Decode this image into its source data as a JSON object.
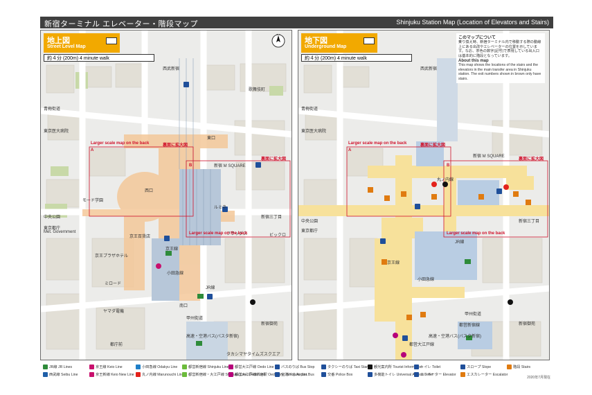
{
  "header": {
    "title_jp": "新宿ターミナル エレベーター・階段マップ",
    "title_en": "Shinjuku Station Map (Location of Elevators and Stairs)"
  },
  "street_map": {
    "title_jp": "地上図",
    "title_en": "Street Level Map",
    "walk": "約４分 (200m) 4 minute walk",
    "compass": "N",
    "labels": {
      "mode_gakuen": "モード学園",
      "seibu_shinjuku": "西武新宿",
      "kabukicho": "歌舞伎町",
      "ome_kaido": "青梅街道",
      "tokyo_med": "東京医大病院",
      "chuo_park": "中央公園",
      "tokyo_tocho": "東京都庁",
      "metro_gov": "Met. Government",
      "keio_plaza": "京王プラザホテル",
      "mylord": "ミロード",
      "shinjuku_m": "新宿 M SQUARE",
      "koshu_kaido": "甲州街道",
      "shinjuku_gyoen": "新宿御苑",
      "takashimaya": "タカシマヤタイムズスクエア",
      "busta": "高速・空港バス(バスタ新宿)",
      "odakyu": "小田急線",
      "jr_line": "JR線",
      "keio_line": "京王線",
      "shinjuku_3": "新宿三丁目",
      "tochomae": "都庁前",
      "nishi_guchi": "西口",
      "higashi_guchi": "東口",
      "minami_guchi": "南口",
      "flags": "フラッグス",
      "bicqlo": "ビックロ",
      "lumine": "ルミネ",
      "yamada": "ヤマダ電機",
      "hoteru": "京王百貨店",
      "large_a": "Larger scale map on the back",
      "large_b": "Larger scale map on the back",
      "a": "A",
      "b": "B",
      "reverse_a": "裏面に拡大図",
      "reverse_b": "裏面に拡大図"
    }
  },
  "underground_map": {
    "title_jp": "地下図",
    "title_en": "Underground Map",
    "walk": "約４分 (200m) 4 minute walk",
    "notice": {
      "h1": "このマップについて",
      "p1": "乗り換え時、新宿ターミナル内で移動する際の動線上にある出改やエレベーターの位置を示しています。なお、茶色の数字(記号)で表現している出入口は基本的に階段となっています。",
      "h2": "About this map",
      "p2": "This map shows the locations of the stairs and the elevators in the main transfer area in Shinjuku station. The exit numbers shown in brown only have stairs."
    },
    "labels": {
      "seibu_shinjuku": "西武新宿",
      "ome_kaido": "青梅街道",
      "tokyo_med": "東京医大病院",
      "chuo_park": "中央公園",
      "tokyo_tocho": "東京都庁",
      "marunouchi": "丸ノ内線",
      "oedo": "都営大江戸線",
      "shinjuku_line": "都営新宿線",
      "keio_line": "京王線",
      "odakyu": "小田急線",
      "jr_line": "JR線",
      "shinjuku_3": "新宿三丁目",
      "shinjuku_gyoen": "新宿御苑",
      "busta": "高速・空港バス(バスタ新宿)",
      "shinjuku_m": "新宿 M SQUARE",
      "large_a": "Larger scale map on the back",
      "large_b": "Larger scale map on the back",
      "a": "A",
      "b": "B",
      "reverse_a": "裏面に拡大図",
      "reverse_b": "裏面に拡大図",
      "koshu_kaido": "甲州街道"
    }
  },
  "legend": {
    "items": [
      {
        "jp": "JR線",
        "en": "JR Lines",
        "color": "#2e8b3a"
      },
      {
        "jp": "西武線",
        "en": "Seibu Line",
        "color": "#1f5fa8"
      },
      {
        "jp": "京王線",
        "en": "Keio Line",
        "color": "#c8106d"
      },
      {
        "jp": "京王新線",
        "en": "Keio New Line",
        "color": "#c8106d"
      },
      {
        "jp": "小田急線",
        "en": "Odakyu Line",
        "color": "#1f7fc8"
      },
      {
        "jp": "丸ノ内線",
        "en": "Marunouchi Line",
        "color": "#e3221b"
      },
      {
        "jp": "都営新宿線",
        "en": "Shinjuku Line",
        "color": "#6cbb3c"
      },
      {
        "jp": "都営新宿線・大江戸線",
        "en": "Shinjuku Line, Oedo Line",
        "color": "#6cbb3c"
      },
      {
        "jp": "都営大江戸線",
        "en": "Oedo Line",
        "color": "#b6007a"
      },
      {
        "jp": "都営大江戸線新宿駅",
        "en": "Oedo Line, Shinjuku Sta.",
        "color": "#b6007a"
      },
      {
        "jp": "バスのりば",
        "en": "Bus Stop",
        "color": "#1f4f9a"
      },
      {
        "jp": "空港バス",
        "en": "Airport Bus",
        "color": "#1f4f9a"
      },
      {
        "jp": "タクシーのりば",
        "en": "Taxi Stand",
        "color": "#1f4f9a"
      },
      {
        "jp": "交番",
        "en": "Police Box",
        "color": "#1f4f9a"
      },
      {
        "jp": "観光案内所",
        "en": "Tourist Information",
        "color": "#111111"
      },
      {
        "jp": "多機能トイレ",
        "en": "Universal Access Toilet",
        "color": "#1f4f9a"
      },
      {
        "jp": "トイレ",
        "en": "Toilet",
        "color": "#1f4f9a"
      },
      {
        "jp": "エレベーター",
        "en": "Elevator",
        "color": "#1f4f9a"
      },
      {
        "jp": "スロープ",
        "en": "Slope",
        "color": "#1f4f9a"
      },
      {
        "jp": "エスカレーター",
        "en": "Escalator",
        "color": "#e07b10"
      },
      {
        "jp": "階段",
        "en": "Stairs",
        "color": "#e07b10"
      }
    ],
    "date": "2020年7月現在"
  }
}
